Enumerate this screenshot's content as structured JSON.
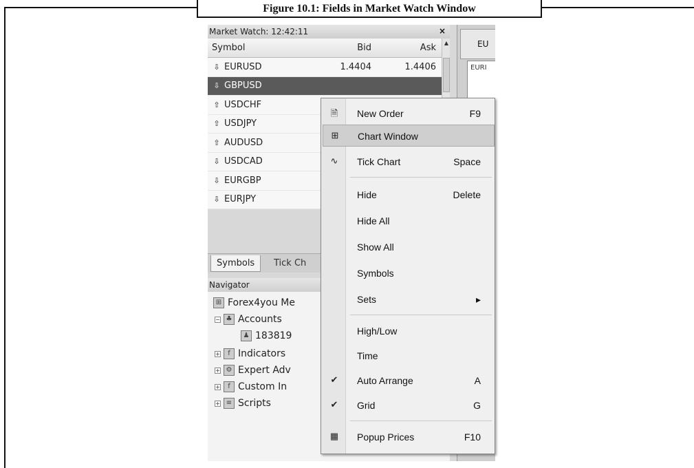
{
  "caption": "Figure 10.1: Fields in Market Watch Window",
  "market_watch": {
    "title": "Market Watch: 12:42:11",
    "close_glyph": "×",
    "headers": {
      "symbol": "Symbol",
      "bid": "Bid",
      "ask": "Ask"
    },
    "rows": [
      {
        "symbol": "EURUSD",
        "bid": "1.4404",
        "ask": "1.4406",
        "direction": "down",
        "arrow": "⇩"
      },
      {
        "symbol": "GBPUSD",
        "bid": "",
        "ask": "",
        "direction": "down",
        "arrow": "⇩",
        "selected": true
      },
      {
        "symbol": "USDCHF",
        "bid": "",
        "ask": "",
        "direction": "up",
        "arrow": "⇧"
      },
      {
        "symbol": "USDJPY",
        "bid": "",
        "ask": "",
        "direction": "up",
        "arrow": "⇧"
      },
      {
        "symbol": "AUDUSD",
        "bid": "",
        "ask": "",
        "direction": "up",
        "arrow": "⇧"
      },
      {
        "symbol": "USDCAD",
        "bid": "",
        "ask": "",
        "direction": "down",
        "arrow": "⇩"
      },
      {
        "symbol": "EURGBP",
        "bid": "",
        "ask": "",
        "direction": "down",
        "arrow": "⇩"
      },
      {
        "symbol": "EURJPY",
        "bid": "",
        "ask": "",
        "direction": "down",
        "arrow": "⇩"
      }
    ],
    "tabs": [
      "Symbols",
      "Tick Ch"
    ]
  },
  "navigator": {
    "title": "Navigator",
    "items": [
      {
        "label": "Forex4you Me",
        "icon": "terminal-icon"
      },
      {
        "label": "Accounts",
        "icon": "accounts-icon"
      },
      {
        "label": "183819",
        "icon": "user-icon"
      },
      {
        "label": "Indicators",
        "icon": "indicator-icon"
      },
      {
        "label": "Expert Adv",
        "icon": "expert-icon"
      },
      {
        "label": "Custom In",
        "icon": "custom-indicator-icon"
      },
      {
        "label": "Scripts",
        "icon": "script-icon"
      }
    ]
  },
  "chart_window": {
    "tab_label": "EU",
    "inner_label": "EURI"
  },
  "context_menu": {
    "items": [
      {
        "label": "New Order",
        "shortcut": "F9",
        "icon": "new-order-icon"
      },
      {
        "label": "Chart Window",
        "shortcut": "",
        "icon": "chart-window-icon",
        "highlighted": true
      },
      {
        "label": "Tick Chart",
        "shortcut": "Space",
        "icon": "tick-chart-icon"
      },
      {
        "label": "Hide",
        "shortcut": "Delete"
      },
      {
        "label": "Hide All",
        "shortcut": ""
      },
      {
        "label": "Show All",
        "shortcut": ""
      },
      {
        "label": "Symbols",
        "shortcut": ""
      },
      {
        "label": "Sets",
        "shortcut": "▸",
        "submenu": true
      },
      {
        "label": "High/Low",
        "shortcut": ""
      },
      {
        "label": "Time",
        "shortcut": ""
      },
      {
        "label": "Auto Arrange",
        "shortcut": "A",
        "checked": true
      },
      {
        "label": "Grid",
        "shortcut": "G",
        "checked": true
      },
      {
        "label": "Popup Prices",
        "shortcut": "F10",
        "icon": "popup-prices-icon"
      }
    ],
    "check_glyph": "✔"
  },
  "colors": {
    "selected_row": "#5a5a5a",
    "menu_highlight": "#cfcfcf"
  }
}
